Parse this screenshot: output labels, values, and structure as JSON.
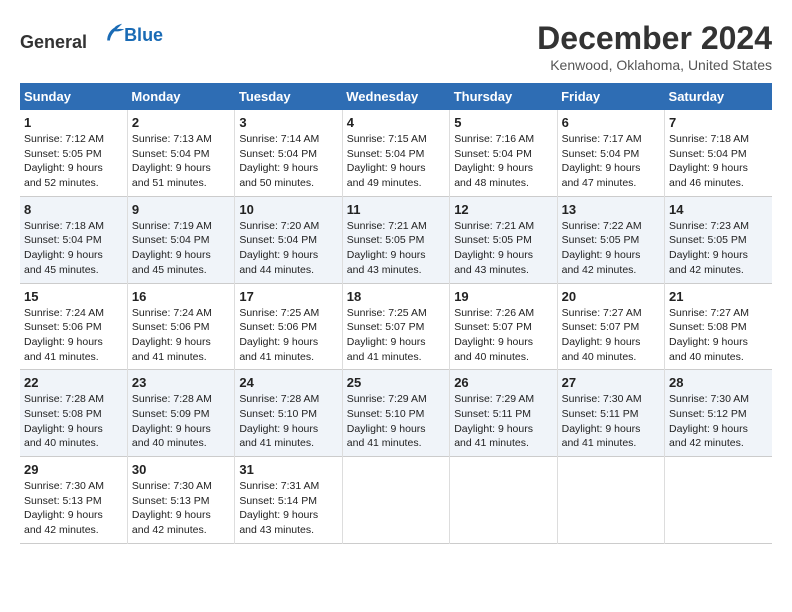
{
  "logo": {
    "line1": "General",
    "line2": "Blue"
  },
  "title": "December 2024",
  "subtitle": "Kenwood, Oklahoma, United States",
  "days_header": [
    "Sunday",
    "Monday",
    "Tuesday",
    "Wednesday",
    "Thursday",
    "Friday",
    "Saturday"
  ],
  "weeks": [
    [
      {
        "day": "1",
        "sunrise": "Sunrise: 7:12 AM",
        "sunset": "Sunset: 5:05 PM",
        "daylight": "Daylight: 9 hours and 52 minutes."
      },
      {
        "day": "2",
        "sunrise": "Sunrise: 7:13 AM",
        "sunset": "Sunset: 5:04 PM",
        "daylight": "Daylight: 9 hours and 51 minutes."
      },
      {
        "day": "3",
        "sunrise": "Sunrise: 7:14 AM",
        "sunset": "Sunset: 5:04 PM",
        "daylight": "Daylight: 9 hours and 50 minutes."
      },
      {
        "day": "4",
        "sunrise": "Sunrise: 7:15 AM",
        "sunset": "Sunset: 5:04 PM",
        "daylight": "Daylight: 9 hours and 49 minutes."
      },
      {
        "day": "5",
        "sunrise": "Sunrise: 7:16 AM",
        "sunset": "Sunset: 5:04 PM",
        "daylight": "Daylight: 9 hours and 48 minutes."
      },
      {
        "day": "6",
        "sunrise": "Sunrise: 7:17 AM",
        "sunset": "Sunset: 5:04 PM",
        "daylight": "Daylight: 9 hours and 47 minutes."
      },
      {
        "day": "7",
        "sunrise": "Sunrise: 7:18 AM",
        "sunset": "Sunset: 5:04 PM",
        "daylight": "Daylight: 9 hours and 46 minutes."
      }
    ],
    [
      {
        "day": "8",
        "sunrise": "Sunrise: 7:18 AM",
        "sunset": "Sunset: 5:04 PM",
        "daylight": "Daylight: 9 hours and 45 minutes."
      },
      {
        "day": "9",
        "sunrise": "Sunrise: 7:19 AM",
        "sunset": "Sunset: 5:04 PM",
        "daylight": "Daylight: 9 hours and 45 minutes."
      },
      {
        "day": "10",
        "sunrise": "Sunrise: 7:20 AM",
        "sunset": "Sunset: 5:04 PM",
        "daylight": "Daylight: 9 hours and 44 minutes."
      },
      {
        "day": "11",
        "sunrise": "Sunrise: 7:21 AM",
        "sunset": "Sunset: 5:05 PM",
        "daylight": "Daylight: 9 hours and 43 minutes."
      },
      {
        "day": "12",
        "sunrise": "Sunrise: 7:21 AM",
        "sunset": "Sunset: 5:05 PM",
        "daylight": "Daylight: 9 hours and 43 minutes."
      },
      {
        "day": "13",
        "sunrise": "Sunrise: 7:22 AM",
        "sunset": "Sunset: 5:05 PM",
        "daylight": "Daylight: 9 hours and 42 minutes."
      },
      {
        "day": "14",
        "sunrise": "Sunrise: 7:23 AM",
        "sunset": "Sunset: 5:05 PM",
        "daylight": "Daylight: 9 hours and 42 minutes."
      }
    ],
    [
      {
        "day": "15",
        "sunrise": "Sunrise: 7:24 AM",
        "sunset": "Sunset: 5:06 PM",
        "daylight": "Daylight: 9 hours and 41 minutes."
      },
      {
        "day": "16",
        "sunrise": "Sunrise: 7:24 AM",
        "sunset": "Sunset: 5:06 PM",
        "daylight": "Daylight: 9 hours and 41 minutes."
      },
      {
        "day": "17",
        "sunrise": "Sunrise: 7:25 AM",
        "sunset": "Sunset: 5:06 PM",
        "daylight": "Daylight: 9 hours and 41 minutes."
      },
      {
        "day": "18",
        "sunrise": "Sunrise: 7:25 AM",
        "sunset": "Sunset: 5:07 PM",
        "daylight": "Daylight: 9 hours and 41 minutes."
      },
      {
        "day": "19",
        "sunrise": "Sunrise: 7:26 AM",
        "sunset": "Sunset: 5:07 PM",
        "daylight": "Daylight: 9 hours and 40 minutes."
      },
      {
        "day": "20",
        "sunrise": "Sunrise: 7:27 AM",
        "sunset": "Sunset: 5:07 PM",
        "daylight": "Daylight: 9 hours and 40 minutes."
      },
      {
        "day": "21",
        "sunrise": "Sunrise: 7:27 AM",
        "sunset": "Sunset: 5:08 PM",
        "daylight": "Daylight: 9 hours and 40 minutes."
      }
    ],
    [
      {
        "day": "22",
        "sunrise": "Sunrise: 7:28 AM",
        "sunset": "Sunset: 5:08 PM",
        "daylight": "Daylight: 9 hours and 40 minutes."
      },
      {
        "day": "23",
        "sunrise": "Sunrise: 7:28 AM",
        "sunset": "Sunset: 5:09 PM",
        "daylight": "Daylight: 9 hours and 40 minutes."
      },
      {
        "day": "24",
        "sunrise": "Sunrise: 7:28 AM",
        "sunset": "Sunset: 5:10 PM",
        "daylight": "Daylight: 9 hours and 41 minutes."
      },
      {
        "day": "25",
        "sunrise": "Sunrise: 7:29 AM",
        "sunset": "Sunset: 5:10 PM",
        "daylight": "Daylight: 9 hours and 41 minutes."
      },
      {
        "day": "26",
        "sunrise": "Sunrise: 7:29 AM",
        "sunset": "Sunset: 5:11 PM",
        "daylight": "Daylight: 9 hours and 41 minutes."
      },
      {
        "day": "27",
        "sunrise": "Sunrise: 7:30 AM",
        "sunset": "Sunset: 5:11 PM",
        "daylight": "Daylight: 9 hours and 41 minutes."
      },
      {
        "day": "28",
        "sunrise": "Sunrise: 7:30 AM",
        "sunset": "Sunset: 5:12 PM",
        "daylight": "Daylight: 9 hours and 42 minutes."
      }
    ],
    [
      {
        "day": "29",
        "sunrise": "Sunrise: 7:30 AM",
        "sunset": "Sunset: 5:13 PM",
        "daylight": "Daylight: 9 hours and 42 minutes."
      },
      {
        "day": "30",
        "sunrise": "Sunrise: 7:30 AM",
        "sunset": "Sunset: 5:13 PM",
        "daylight": "Daylight: 9 hours and 42 minutes."
      },
      {
        "day": "31",
        "sunrise": "Sunrise: 7:31 AM",
        "sunset": "Sunset: 5:14 PM",
        "daylight": "Daylight: 9 hours and 43 minutes."
      },
      {
        "day": "",
        "sunrise": "",
        "sunset": "",
        "daylight": ""
      },
      {
        "day": "",
        "sunrise": "",
        "sunset": "",
        "daylight": ""
      },
      {
        "day": "",
        "sunrise": "",
        "sunset": "",
        "daylight": ""
      },
      {
        "day": "",
        "sunrise": "",
        "sunset": "",
        "daylight": ""
      }
    ]
  ]
}
